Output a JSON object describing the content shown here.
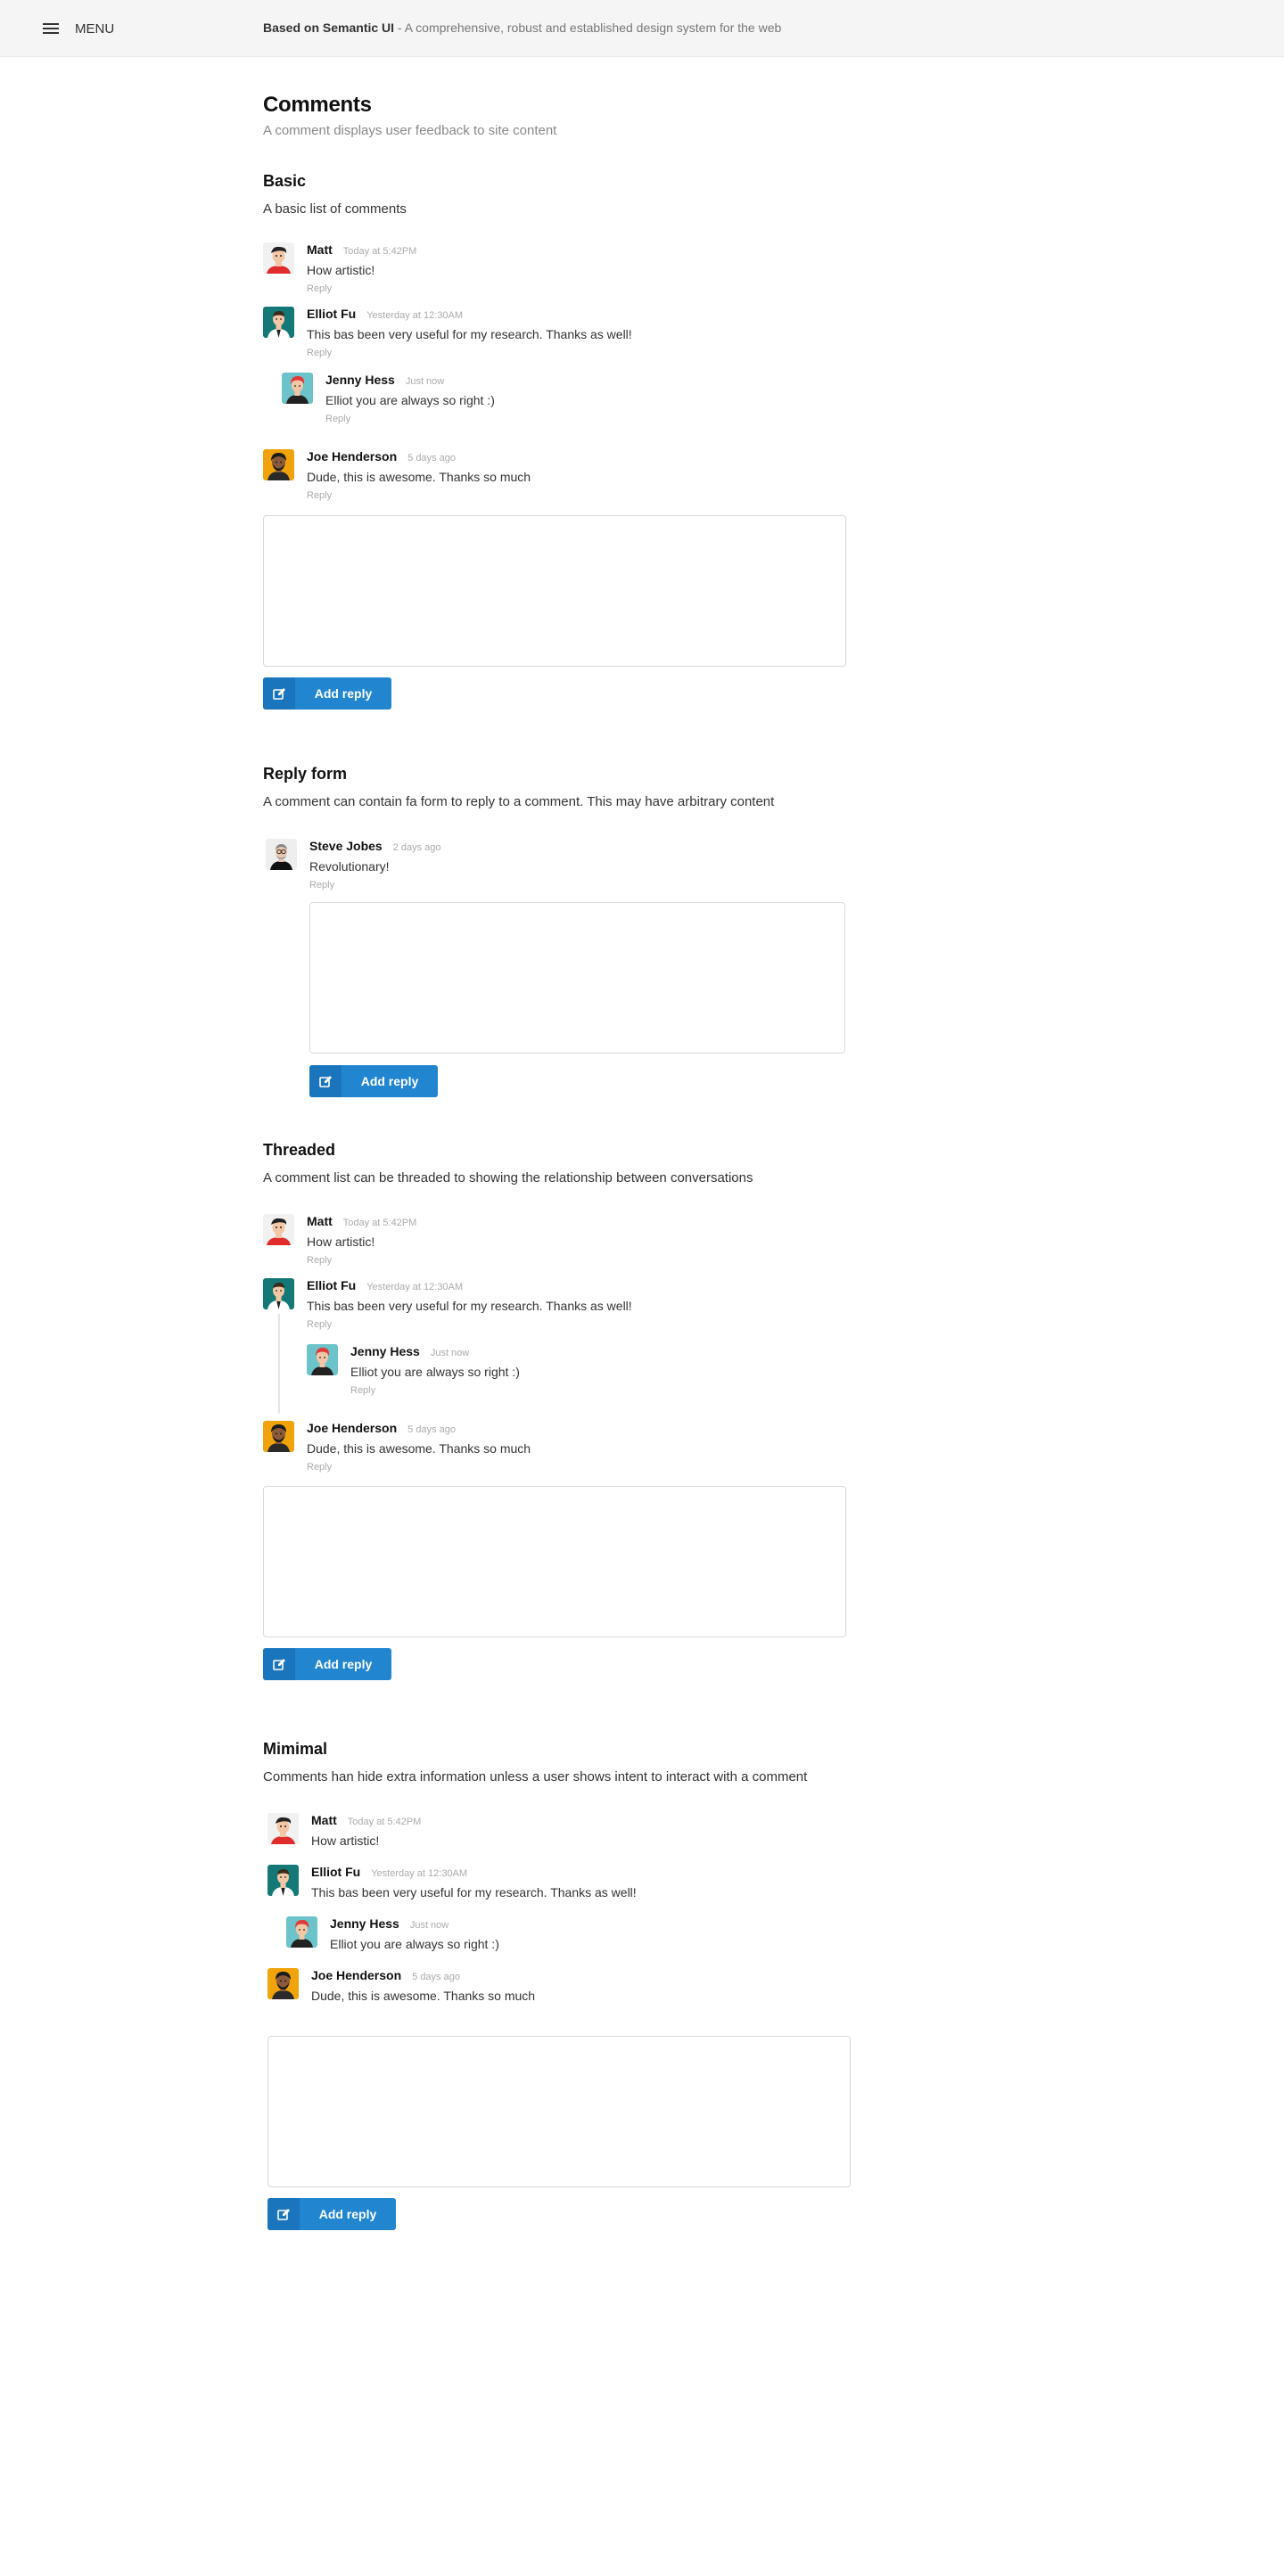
{
  "header": {
    "menu_label": "MENU",
    "banner_strong": "Based on Semantic UI",
    "banner_rest": " - A comprehensive, robust and established design system for the web"
  },
  "page": {
    "title": "Comments",
    "subtitle": "A comment displays user feedback to site content"
  },
  "sections": [
    {
      "title": "Basic",
      "desc": "A basic list of comments"
    },
    {
      "title": "Reply form",
      "desc": "A comment can contain fa form to reply to a comment. This may have arbitrary content"
    },
    {
      "title": "Threaded",
      "desc": "A comment list can be threaded to showing the relationship between conversations"
    },
    {
      "title": "Mimimal",
      "desc": "Comments han hide extra information unless a user shows intent to interact with a comment"
    }
  ],
  "comments": {
    "matt": {
      "author": "Matt",
      "meta": "Today at 5:42PM",
      "text": "How artistic!"
    },
    "elliot": {
      "author": "Elliot Fu",
      "meta": "Yesterday at 12:30AM",
      "text": "This bas been very useful for my research. Thanks as well!"
    },
    "jenny": {
      "author": "Jenny Hess",
      "meta": "Just now",
      "text": "Elliot you are always so right :)"
    },
    "joe": {
      "author": "Joe Henderson",
      "meta": "5 days ago",
      "text": "Dude, this is awesome. Thanks so much"
    },
    "steve": {
      "author": "Steve Jobes",
      "meta": "2 days ago",
      "text": "Revolutionary!"
    }
  },
  "reply_label": "Reply",
  "add_reply_label": "Add reply",
  "colors": {
    "accent": "#2185d0",
    "muted": "#aaaaaa"
  }
}
